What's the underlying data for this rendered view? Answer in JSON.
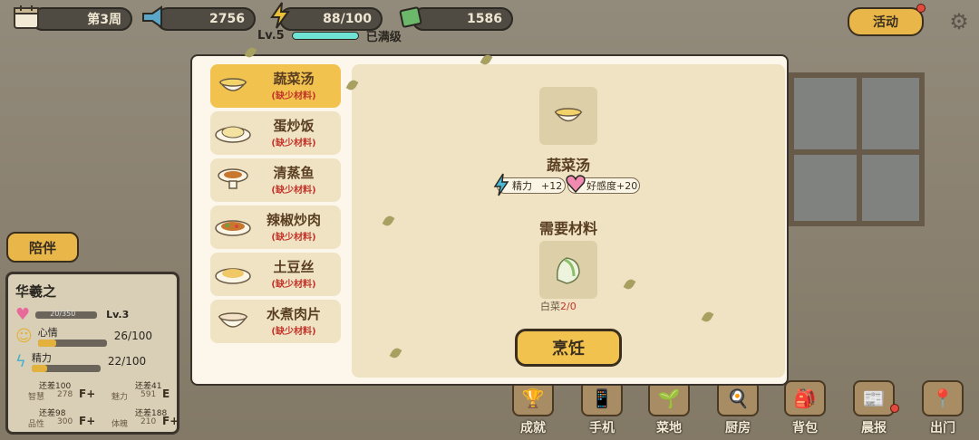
{
  "hud": {
    "week": "第3周",
    "fame": "2756",
    "energy": "88/100",
    "money": "1586",
    "level": "Lv.5",
    "level_status": "已满级",
    "event_label": "活动"
  },
  "side": {
    "accompany_label": "陪伴",
    "character": {
      "name": "华羲之",
      "affection_value": "20/350",
      "char_level": "Lv.3",
      "mood_label": "心情",
      "mood_value": "26/100",
      "mood_fraction": 0.26,
      "stamina_label": "精力",
      "stamina_value": "22/100",
      "stamina_fraction": 0.22,
      "attrs": [
        {
          "label": "智慧",
          "value": "278",
          "grade": "F+",
          "need": "还差100"
        },
        {
          "label": "魅力",
          "value": "591",
          "grade": "E",
          "need": "还差41"
        },
        {
          "label": "品性",
          "value": "300",
          "grade": "F+",
          "need": "还差98"
        },
        {
          "label": "体魄",
          "value": "210",
          "grade": "F+",
          "need": "还差188"
        }
      ]
    }
  },
  "bottom_nav": [
    "成就",
    "手机",
    "菜地",
    "厨房",
    "背包",
    "晨报",
    "出门"
  ],
  "cooking": {
    "recipes": [
      {
        "name": "蔬菜汤",
        "status": "(缺少材料)",
        "active": true
      },
      {
        "name": "蛋炒饭",
        "status": "(缺少材料)",
        "active": false
      },
      {
        "name": "清蒸鱼",
        "status": "(缺少材料)",
        "active": false
      },
      {
        "name": "辣椒炒肉",
        "status": "(缺少材料)",
        "active": false
      },
      {
        "name": "土豆丝",
        "status": "(缺少材料)",
        "active": false
      },
      {
        "name": "水煮肉片",
        "status": "(缺少材料)",
        "active": false
      }
    ],
    "selected_name": "蔬菜汤",
    "effect_stamina_label": "精力",
    "effect_stamina_value": "+12",
    "effect_affection": "好感度+20",
    "materials_title": "需要材料",
    "material_name": "白菜",
    "material_count": "2/0",
    "cook_label": "烹饪"
  },
  "colors": {
    "accent": "#f2c24e",
    "warning": "#c2352a",
    "energy_bar": "#6fe3d4"
  }
}
